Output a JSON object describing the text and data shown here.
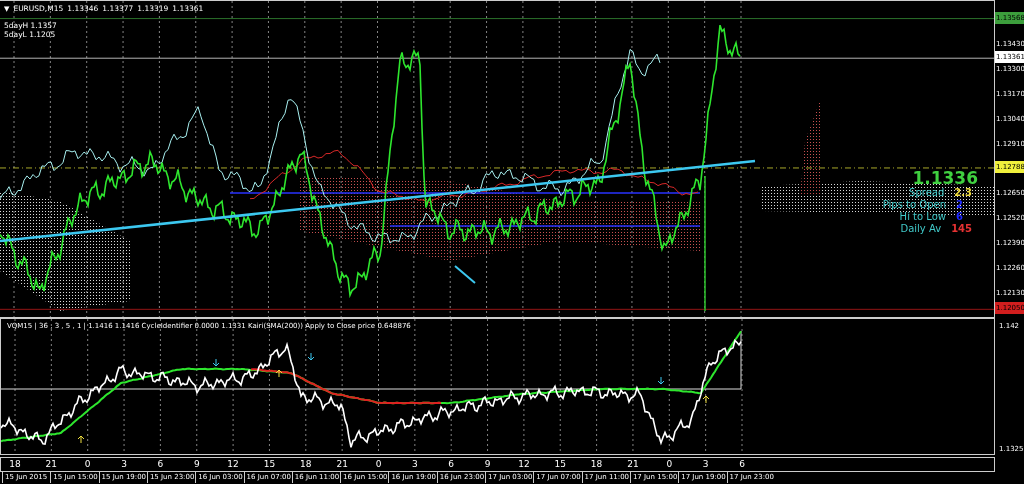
{
  "chart": {
    "menu_marker": "▼",
    "symbol": "EURUSD,M15",
    "ohlc": [
      "1.13346",
      "1.13377",
      "1.13319",
      "1.13361"
    ],
    "levels": [
      {
        "label": "5dayH",
        "value": "1.1357"
      },
      {
        "label": "5dayL",
        "value": "1.1205"
      }
    ],
    "price_axis": [
      "1.13430",
      "1.13300",
      "1.13170",
      "1.13040",
      "1.12910",
      "1.12650",
      "1.12520",
      "1.12390",
      "1.12260",
      "1.12130"
    ],
    "price_markers": [
      {
        "value": "1.13568",
        "color": "#3c9e3c"
      },
      {
        "value": "1.13361",
        "color": "#ffffff"
      },
      {
        "value": "1.12788",
        "color": "#f0f03c"
      },
      {
        "value": "1.12050",
        "color": "#d21e1e"
      }
    ],
    "info": {
      "price": "1.1336",
      "rows": [
        {
          "label": "Spread",
          "value": "2.3",
          "color": "#f0dc3c"
        },
        {
          "label": "Pips to Open",
          "value": "2",
          "color": "#1e28ff"
        },
        {
          "label": "Hi to Low",
          "value": "6",
          "color": "#1e28ff"
        },
        {
          "label": "Daily Av",
          "value": "145",
          "color": "#e63232"
        }
      ]
    }
  },
  "indicator": {
    "header": "VQM15 | 36 , 3 , 5 , 1 |  1.1416 1.1416  CycleIdentifier 0.0000 1.1331  Kairi(SMA(200)) Apply to Close price 0.648876",
    "axis": [
      "1.142",
      "1.1325"
    ]
  },
  "time_axis": {
    "hours": [
      "18",
      "21",
      "0",
      "3",
      "6",
      "9",
      "12",
      "15",
      "18",
      "21",
      "0",
      "3",
      "6",
      "9",
      "12",
      "15",
      "18",
      "21",
      "0",
      "3",
      "6"
    ],
    "dates": [
      "15 Jun 2015",
      "15 Jun 15:00",
      "15 Jun 19:00",
      "15 Jun 23:00",
      "16 Jun 03:00",
      "16 Jun 07:00",
      "16 Jun 11:00",
      "16 Jun 15:00",
      "16 Jun 19:00",
      "16 Jun 23:00",
      "17 Jun 03:00",
      "17 Jun 07:00",
      "17 Jun 11:00",
      "17 Jun 15:00",
      "17 Jun 19:00",
      "17 Jun 23:00"
    ]
  }
}
